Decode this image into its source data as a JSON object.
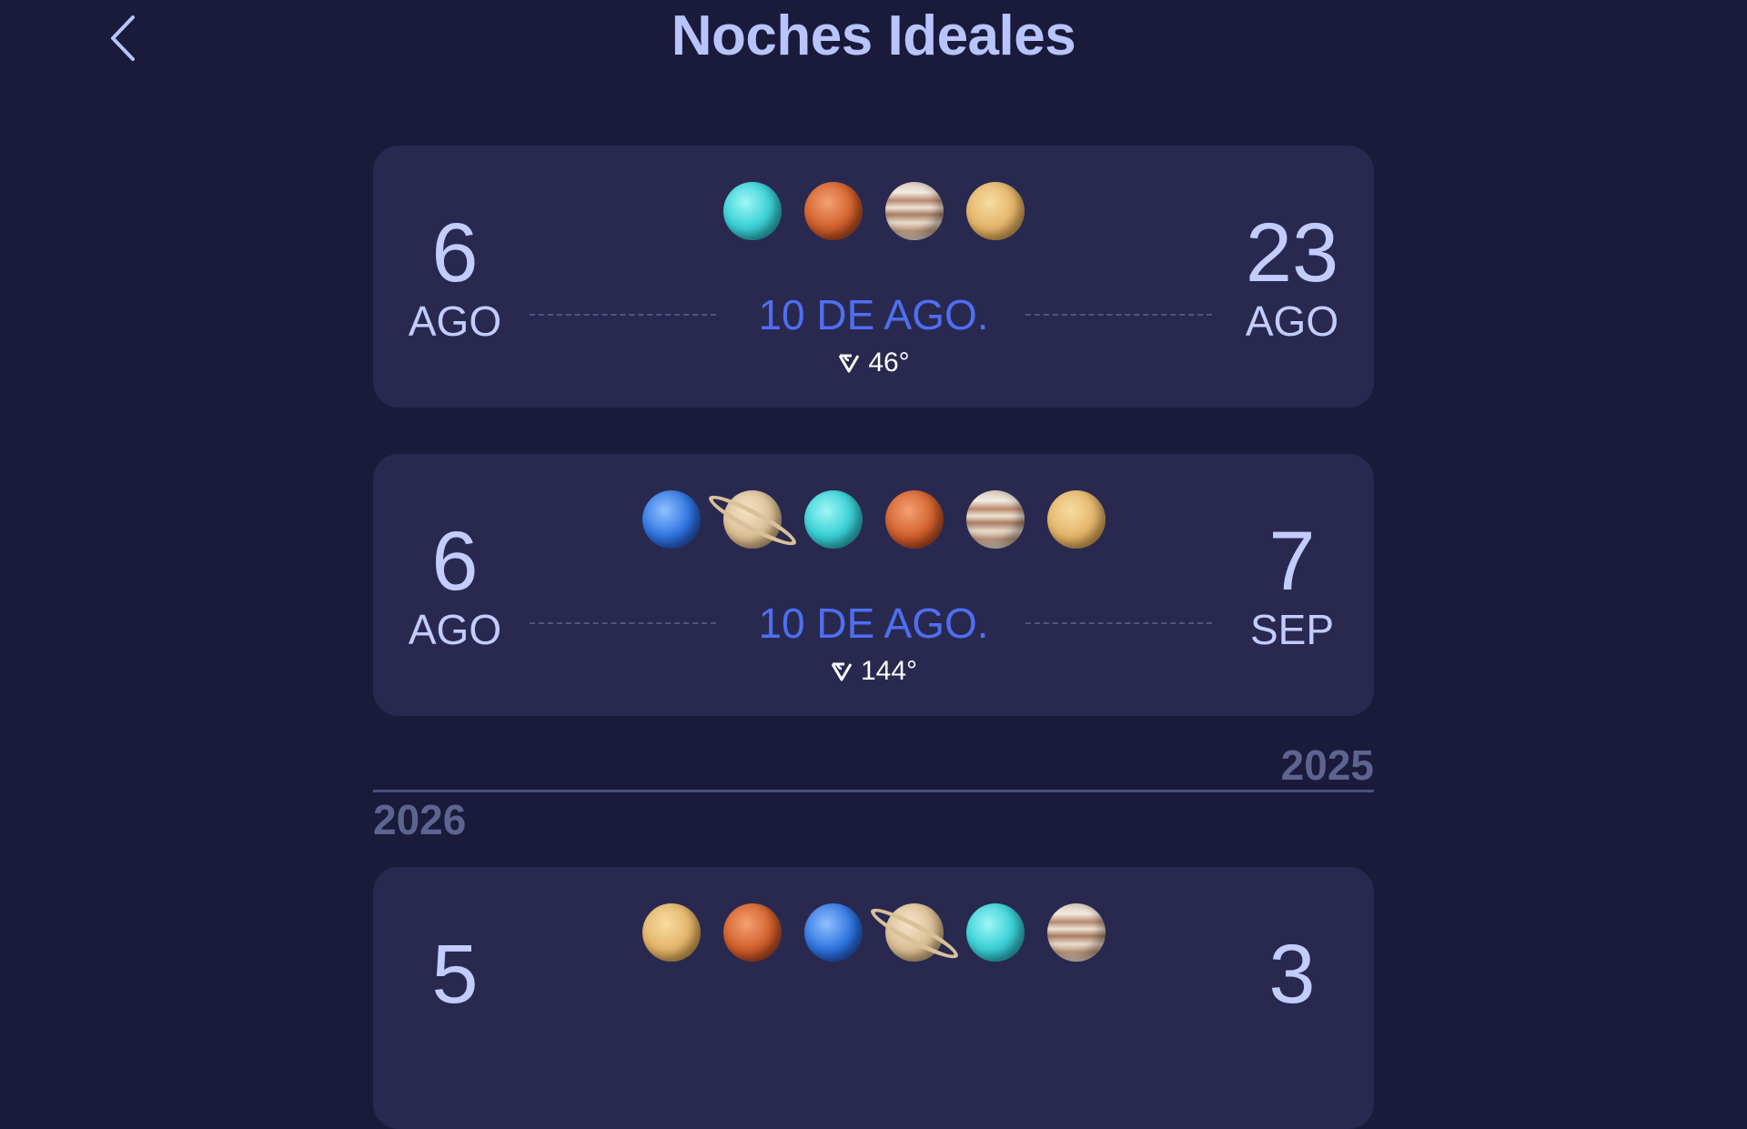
{
  "header": {
    "title": "Noches Ideales",
    "back_icon": "chevron-left-icon"
  },
  "cards": [
    {
      "planets": [
        "uranus",
        "mars",
        "jupiter",
        "venus"
      ],
      "start": {
        "day": "6",
        "month": "AGO"
      },
      "end": {
        "day": "23",
        "month": "AGO"
      },
      "best_date": "10 DE AGO.",
      "angle": "46°"
    },
    {
      "planets": [
        "neptune",
        "saturn",
        "uranus",
        "mars",
        "jupiter",
        "venus"
      ],
      "start": {
        "day": "6",
        "month": "AGO"
      },
      "end": {
        "day": "7",
        "month": "SEP"
      },
      "best_date": "10 DE AGO.",
      "angle": "144°"
    },
    {
      "planets": [
        "venus",
        "mars",
        "neptune",
        "saturn",
        "uranus",
        "jupiter"
      ],
      "start": {
        "day": "5",
        "month": ""
      },
      "end": {
        "day": "3",
        "month": ""
      }
    }
  ],
  "year_divider": {
    "previous_year": "2025",
    "next_year": "2026"
  },
  "colors": {
    "background": "#1a1a3a",
    "card": "#292950",
    "accent": "#4e6ff2",
    "title": "#b8c4ff"
  }
}
